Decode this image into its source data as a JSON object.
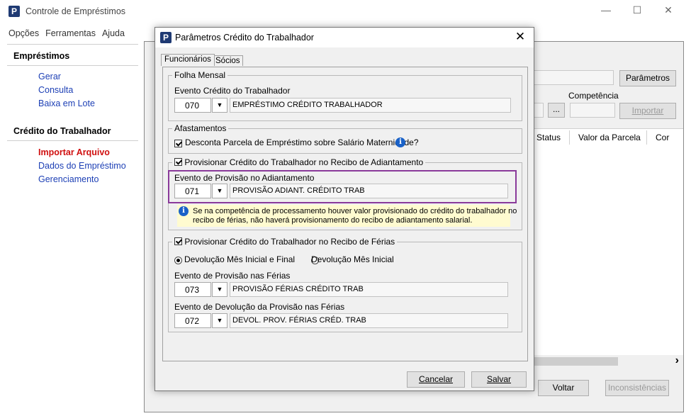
{
  "main": {
    "title": "Controle de Empréstimos",
    "menu": [
      "Opções",
      "Ferramentas",
      "Ajuda"
    ],
    "sidebar": {
      "emprestimos_title": "Empréstimos",
      "emprestimos_items": [
        "Gerar",
        "Consulta",
        "Baixa em Lote"
      ],
      "credito_title": "Crédito do Trabalhador",
      "credito_items": [
        "Importar Arquivo",
        "Dados do Empréstimo",
        "Gerenciamento"
      ]
    },
    "content": {
      "parametros_button": "Parâmetros",
      "competencia_label": "Competência",
      "ellipsis_button": "...",
      "importar_button": "Importar",
      "columns": [
        "Status",
        "Valor da Parcela",
        "Cor"
      ],
      "voltar_button": "Voltar",
      "inconsistencias_button": "Inconsistências",
      "scroll_right": "›"
    }
  },
  "dialog": {
    "title": "Parâmetros Crédito do Trabalhador",
    "close": "✕",
    "tabs": [
      "Funcionários",
      "Sócios"
    ],
    "folha": {
      "group_label": "Folha Mensal",
      "field_label": "Evento Crédito do Trabalhador",
      "code": "070",
      "description": "EMPRÉSTIMO CRÉDITO TRABALHADOR"
    },
    "afastamentos": {
      "group_label": "Afastamentos",
      "checkbox_label": "Desconta Parcela de Empréstimo sobre Salário Maternidade?"
    },
    "adiantamento": {
      "group_label": "Provisionar Crédito do Trabalhador no Recibo de Adiantamento",
      "field_label": "Evento de Provisão no Adiantamento",
      "code": "071",
      "description": "PROVISÃO ADIANT. CRÉDITO TRAB",
      "info_text_1": "Se na competência de processamento houver valor provisionado do crédito do trabalhador no",
      "info_text_2": "recibo de férias, não haverá provisionamento do recibo de adiantamento salarial."
    },
    "ferias": {
      "group_label": "Provisionar Crédito do Trabalhador no Recibo de Férias",
      "radio_1": "Devolução Mês Inicial e Final",
      "radio_2": "Devolução Mês Inicial",
      "prov_label": "Evento de Provisão nas Férias",
      "prov_code": "073",
      "prov_description": "PROVISÃO FÉRIAS CRÉDITO TRAB",
      "dev_label": "Evento de Devolução da Provisão nas Férias",
      "dev_code": "072",
      "dev_description": "DEVOL. PROV. FÉRIAS CRÉD. TRAB"
    },
    "cancel_button": "Cancelar",
    "save_button": "Salvar"
  },
  "colors": {
    "link": "#1c3fb5",
    "active_link": "#d01010",
    "highlight": "#8a3a9a",
    "info_bg": "#fffbd0",
    "logo": "#1f3a73"
  }
}
